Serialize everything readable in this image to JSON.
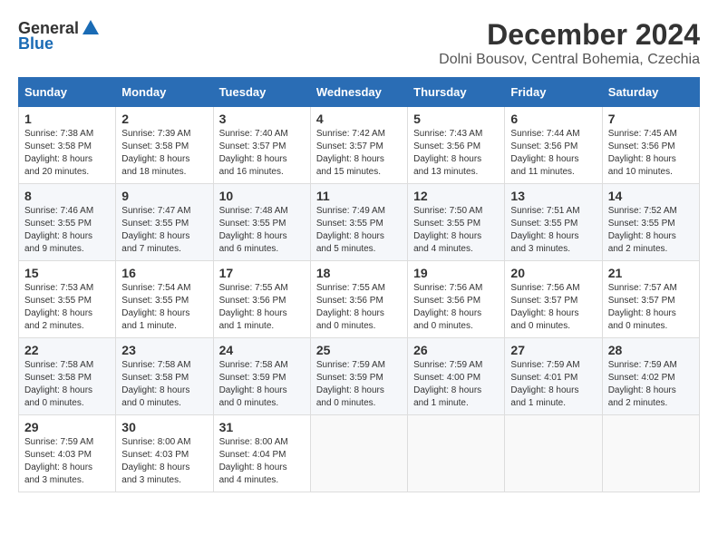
{
  "logo": {
    "general": "General",
    "blue": "Blue"
  },
  "title": {
    "month": "December 2024",
    "location": "Dolni Bousov, Central Bohemia, Czechia"
  },
  "headers": [
    "Sunday",
    "Monday",
    "Tuesday",
    "Wednesday",
    "Thursday",
    "Friday",
    "Saturday"
  ],
  "weeks": [
    [
      {
        "day": "1",
        "sunrise": "7:38 AM",
        "sunset": "3:58 PM",
        "daylight": "8 hours and 20 minutes."
      },
      {
        "day": "2",
        "sunrise": "7:39 AM",
        "sunset": "3:58 PM",
        "daylight": "8 hours and 18 minutes."
      },
      {
        "day": "3",
        "sunrise": "7:40 AM",
        "sunset": "3:57 PM",
        "daylight": "8 hours and 16 minutes."
      },
      {
        "day": "4",
        "sunrise": "7:42 AM",
        "sunset": "3:57 PM",
        "daylight": "8 hours and 15 minutes."
      },
      {
        "day": "5",
        "sunrise": "7:43 AM",
        "sunset": "3:56 PM",
        "daylight": "8 hours and 13 minutes."
      },
      {
        "day": "6",
        "sunrise": "7:44 AM",
        "sunset": "3:56 PM",
        "daylight": "8 hours and 11 minutes."
      },
      {
        "day": "7",
        "sunrise": "7:45 AM",
        "sunset": "3:56 PM",
        "daylight": "8 hours and 10 minutes."
      }
    ],
    [
      {
        "day": "8",
        "sunrise": "7:46 AM",
        "sunset": "3:55 PM",
        "daylight": "8 hours and 9 minutes."
      },
      {
        "day": "9",
        "sunrise": "7:47 AM",
        "sunset": "3:55 PM",
        "daylight": "8 hours and 7 minutes."
      },
      {
        "day": "10",
        "sunrise": "7:48 AM",
        "sunset": "3:55 PM",
        "daylight": "8 hours and 6 minutes."
      },
      {
        "day": "11",
        "sunrise": "7:49 AM",
        "sunset": "3:55 PM",
        "daylight": "8 hours and 5 minutes."
      },
      {
        "day": "12",
        "sunrise": "7:50 AM",
        "sunset": "3:55 PM",
        "daylight": "8 hours and 4 minutes."
      },
      {
        "day": "13",
        "sunrise": "7:51 AM",
        "sunset": "3:55 PM",
        "daylight": "8 hours and 3 minutes."
      },
      {
        "day": "14",
        "sunrise": "7:52 AM",
        "sunset": "3:55 PM",
        "daylight": "8 hours and 2 minutes."
      }
    ],
    [
      {
        "day": "15",
        "sunrise": "7:53 AM",
        "sunset": "3:55 PM",
        "daylight": "8 hours and 2 minutes."
      },
      {
        "day": "16",
        "sunrise": "7:54 AM",
        "sunset": "3:55 PM",
        "daylight": "8 hours and 1 minute."
      },
      {
        "day": "17",
        "sunrise": "7:55 AM",
        "sunset": "3:56 PM",
        "daylight": "8 hours and 1 minute."
      },
      {
        "day": "18",
        "sunrise": "7:55 AM",
        "sunset": "3:56 PM",
        "daylight": "8 hours and 0 minutes."
      },
      {
        "day": "19",
        "sunrise": "7:56 AM",
        "sunset": "3:56 PM",
        "daylight": "8 hours and 0 minutes."
      },
      {
        "day": "20",
        "sunrise": "7:56 AM",
        "sunset": "3:57 PM",
        "daylight": "8 hours and 0 minutes."
      },
      {
        "day": "21",
        "sunrise": "7:57 AM",
        "sunset": "3:57 PM",
        "daylight": "8 hours and 0 minutes."
      }
    ],
    [
      {
        "day": "22",
        "sunrise": "7:58 AM",
        "sunset": "3:58 PM",
        "daylight": "8 hours and 0 minutes."
      },
      {
        "day": "23",
        "sunrise": "7:58 AM",
        "sunset": "3:58 PM",
        "daylight": "8 hours and 0 minutes."
      },
      {
        "day": "24",
        "sunrise": "7:58 AM",
        "sunset": "3:59 PM",
        "daylight": "8 hours and 0 minutes."
      },
      {
        "day": "25",
        "sunrise": "7:59 AM",
        "sunset": "3:59 PM",
        "daylight": "8 hours and 0 minutes."
      },
      {
        "day": "26",
        "sunrise": "7:59 AM",
        "sunset": "4:00 PM",
        "daylight": "8 hours and 1 minute."
      },
      {
        "day": "27",
        "sunrise": "7:59 AM",
        "sunset": "4:01 PM",
        "daylight": "8 hours and 1 minute."
      },
      {
        "day": "28",
        "sunrise": "7:59 AM",
        "sunset": "4:02 PM",
        "daylight": "8 hours and 2 minutes."
      }
    ],
    [
      {
        "day": "29",
        "sunrise": "7:59 AM",
        "sunset": "4:03 PM",
        "daylight": "8 hours and 3 minutes."
      },
      {
        "day": "30",
        "sunrise": "8:00 AM",
        "sunset": "4:03 PM",
        "daylight": "8 hours and 3 minutes."
      },
      {
        "day": "31",
        "sunrise": "8:00 AM",
        "sunset": "4:04 PM",
        "daylight": "8 hours and 4 minutes."
      },
      null,
      null,
      null,
      null
    ]
  ]
}
